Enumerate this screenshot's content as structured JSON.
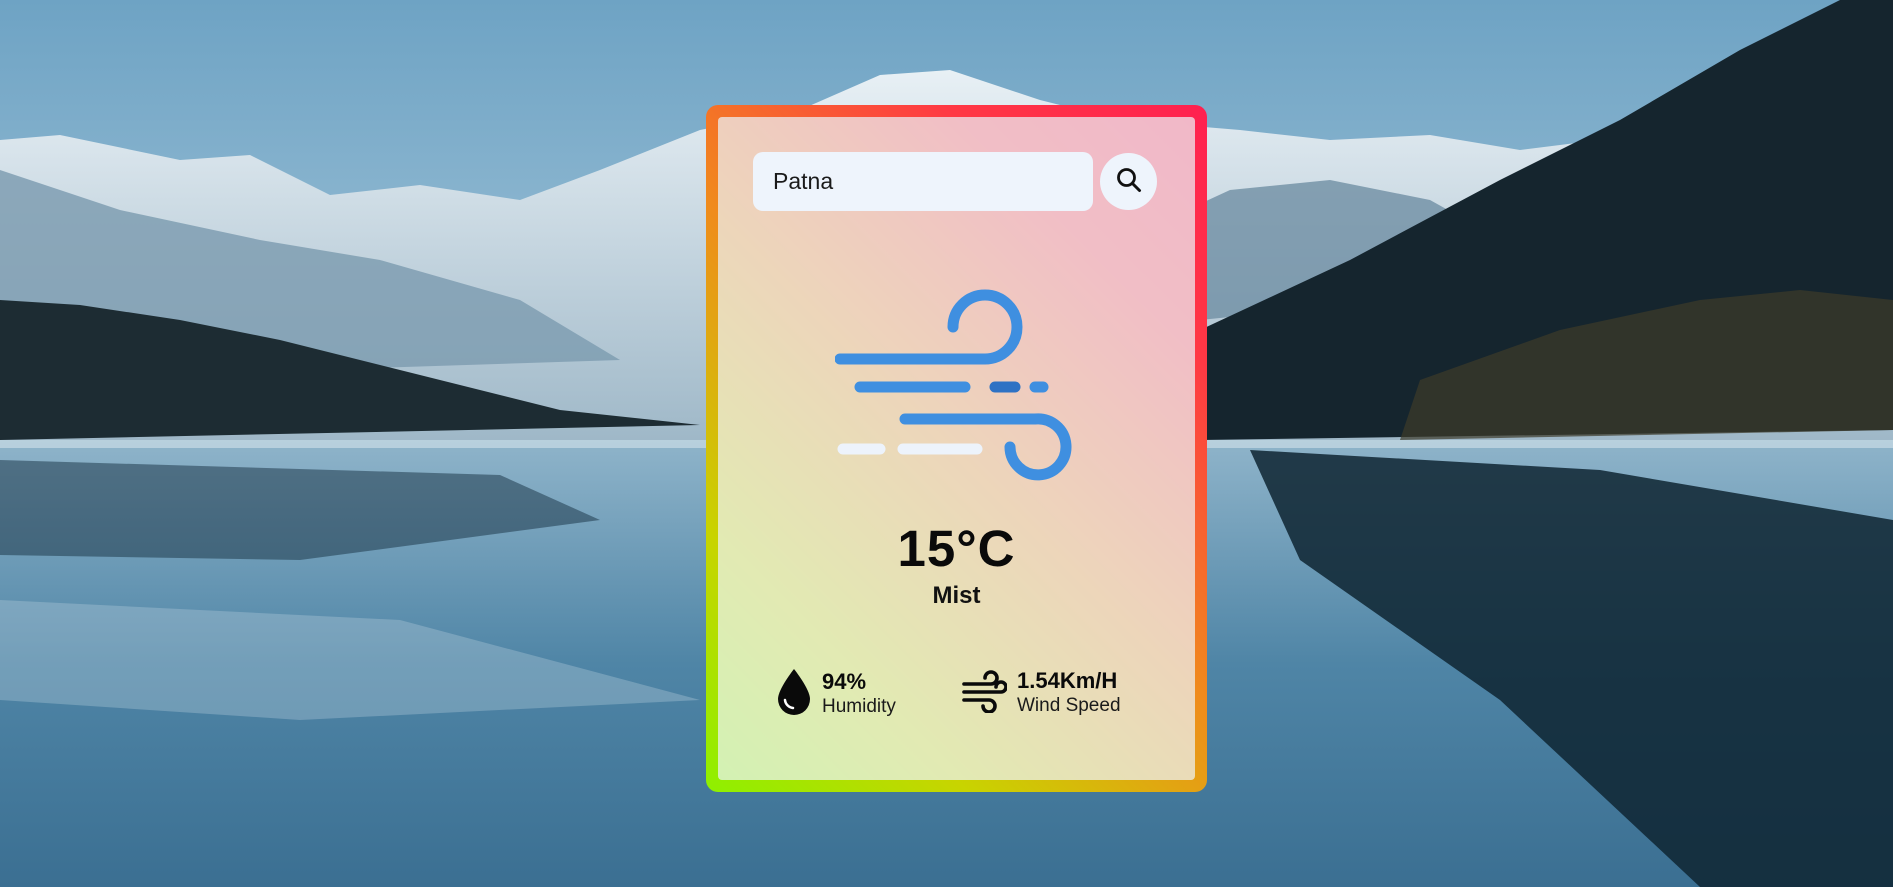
{
  "search": {
    "value": "Patna",
    "button_icon": "search-icon"
  },
  "weather": {
    "icon": "wind-icon",
    "temperature": "15°C",
    "condition": "Mist"
  },
  "humidity": {
    "icon": "water-drop-icon",
    "value": "94%",
    "label": "Humidity"
  },
  "wind": {
    "icon": "wind-small-icon",
    "value": "1.54Km/H",
    "label": "Wind Speed"
  },
  "colors": {
    "icon_blue": "#3f8fe0",
    "border_gradient": [
      "#8ef000",
      "#f08a1c",
      "#ff2050"
    ]
  }
}
